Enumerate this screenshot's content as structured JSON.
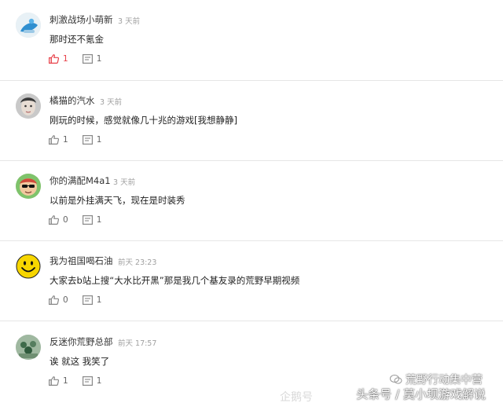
{
  "comments": [
    {
      "username": "刺激战场小萌新",
      "time": "3 天前",
      "content": "那时还不氪金",
      "likes": "1",
      "replies": "1",
      "liked": true,
      "avatar_icon": "blue-cartoon-avatar"
    },
    {
      "username": "橘猫的汽水",
      "time": "3 天前",
      "content": "刚玩的时候，感觉就像几十兆的游戏[我想静静]",
      "likes": "1",
      "replies": "1",
      "liked": false,
      "avatar_icon": "face-photo-avatar"
    },
    {
      "username": "你的满配M4a1",
      "time": "3 天前",
      "content": "以前是外挂满天飞，现在是时装秀",
      "likes": "0",
      "replies": "1",
      "liked": false,
      "avatar_icon": "sunglasses-avatar"
    },
    {
      "username": "我为祖国喝石油",
      "time": "前天 23:23",
      "content": "大家去b站上搜“大水比开黑”那是我几个基友录的荒野早期视频",
      "likes": "0",
      "replies": "1",
      "liked": false,
      "avatar_icon": "smiley-face-avatar"
    },
    {
      "username": "反迷你荒野总部",
      "time": "前天 17:57",
      "content": "诶 就这 我笑了",
      "likes": "1",
      "replies": "1",
      "liked": false,
      "avatar_icon": "green-group-avatar"
    }
  ],
  "watermark": {
    "line1": "荒野行动集中营",
    "line2": "头条号 / 莫小坝游戏解说",
    "logo": "企鹅号"
  },
  "colors": {
    "liked": "#e8424a",
    "icon_default": "#888888",
    "separator": "#e6e6e6",
    "time": "#a0a0a0"
  }
}
